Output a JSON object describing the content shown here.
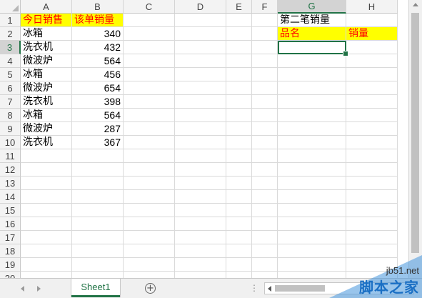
{
  "columns": [
    "A",
    "B",
    "C",
    "D",
    "E",
    "F",
    "G",
    "H"
  ],
  "selected_column": "G",
  "selected_row": 3,
  "rows": [
    {
      "n": "1",
      "cells": [
        "今日销售",
        "该单销量",
        "",
        "",
        "",
        "",
        "第二笔销量",
        ""
      ]
    },
    {
      "n": "2",
      "cells": [
        "冰箱",
        "340",
        "",
        "",
        "",
        "",
        "品名",
        "销量"
      ]
    },
    {
      "n": "3",
      "cells": [
        "洗衣机",
        "432",
        "",
        "",
        "",
        "",
        "",
        ""
      ]
    },
    {
      "n": "4",
      "cells": [
        "微波炉",
        "564",
        "",
        "",
        "",
        "",
        "",
        ""
      ]
    },
    {
      "n": "5",
      "cells": [
        "冰箱",
        "456",
        "",
        "",
        "",
        "",
        "",
        ""
      ]
    },
    {
      "n": "6",
      "cells": [
        "微波炉",
        "654",
        "",
        "",
        "",
        "",
        "",
        ""
      ]
    },
    {
      "n": "7",
      "cells": [
        "洗衣机",
        "398",
        "",
        "",
        "",
        "",
        "",
        ""
      ]
    },
    {
      "n": "8",
      "cells": [
        "冰箱",
        "564",
        "",
        "",
        "",
        "",
        "",
        ""
      ]
    },
    {
      "n": "9",
      "cells": [
        "微波炉",
        "287",
        "",
        "",
        "",
        "",
        "",
        ""
      ]
    },
    {
      "n": "10",
      "cells": [
        "洗衣机",
        "367",
        "",
        "",
        "",
        "",
        "",
        ""
      ]
    },
    {
      "n": "11",
      "cells": [
        "",
        "",
        "",
        "",
        "",
        "",
        "",
        ""
      ]
    },
    {
      "n": "12",
      "cells": [
        "",
        "",
        "",
        "",
        "",
        "",
        "",
        ""
      ]
    },
    {
      "n": "13",
      "cells": [
        "",
        "",
        "",
        "",
        "",
        "",
        "",
        ""
      ]
    },
    {
      "n": "14",
      "cells": [
        "",
        "",
        "",
        "",
        "",
        "",
        "",
        ""
      ]
    },
    {
      "n": "15",
      "cells": [
        "",
        "",
        "",
        "",
        "",
        "",
        "",
        ""
      ]
    },
    {
      "n": "16",
      "cells": [
        "",
        "",
        "",
        "",
        "",
        "",
        "",
        ""
      ]
    },
    {
      "n": "17",
      "cells": [
        "",
        "",
        "",
        "",
        "",
        "",
        "",
        ""
      ]
    },
    {
      "n": "18",
      "cells": [
        "",
        "",
        "",
        "",
        "",
        "",
        "",
        ""
      ]
    },
    {
      "n": "19",
      "cells": [
        "",
        "",
        "",
        "",
        "",
        "",
        "",
        ""
      ]
    },
    {
      "n": "20",
      "cells": [
        "",
        "",
        "",
        "",
        "",
        "",
        "",
        ""
      ]
    }
  ],
  "highlight_cells": [
    "0-0",
    "0-1",
    "1-6",
    "1-7"
  ],
  "colors": {
    "highlight_bg": "#ffff00",
    "highlight_text": "#ff0000",
    "accent": "#217346"
  },
  "sheet_tab": "Sheet1",
  "add_sheet_symbol": "+",
  "scroll_dots": "⋮",
  "watermark": {
    "url": "jb51.net",
    "name": "脚本之家"
  }
}
